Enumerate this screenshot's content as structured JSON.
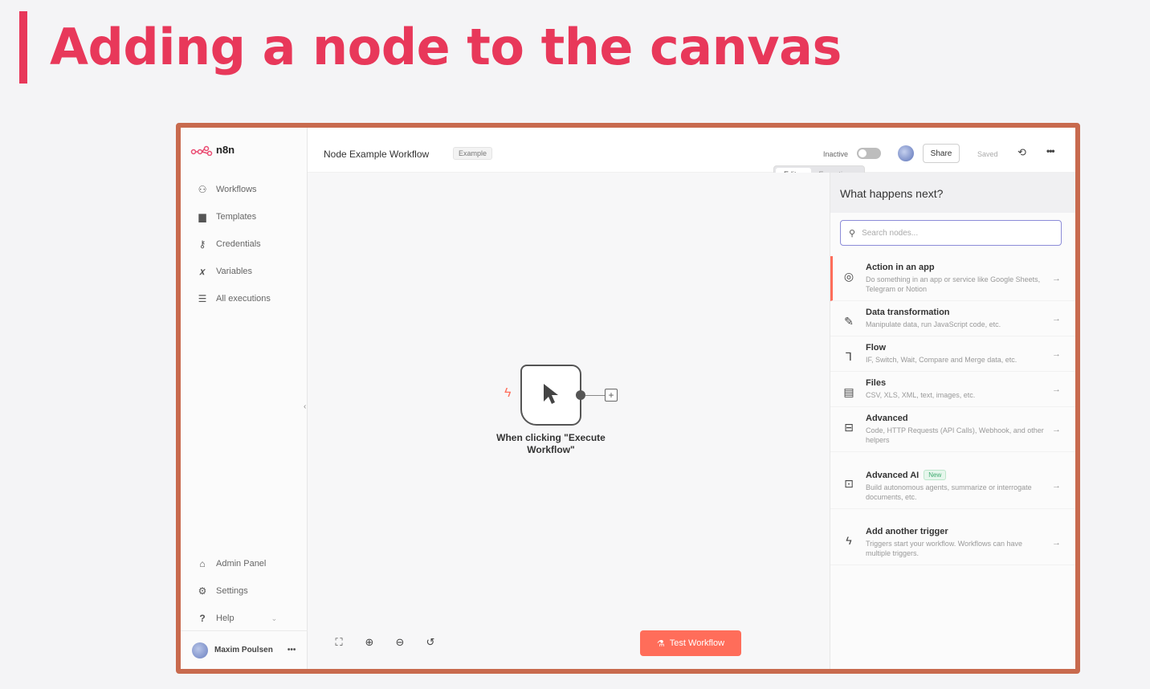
{
  "slide": {
    "title": "Adding a node to the canvas"
  },
  "app": {
    "brand": "n8n"
  },
  "sidebar": {
    "items": [
      {
        "label": "Workflows",
        "icon": "workflows-icon",
        "glyph": "⚇"
      },
      {
        "label": "Templates",
        "icon": "templates-icon",
        "glyph": "▆"
      },
      {
        "label": "Credentials",
        "icon": "key-icon",
        "glyph": "⚷"
      },
      {
        "label": "Variables",
        "icon": "variables-icon",
        "glyph": "𝑥"
      },
      {
        "label": "All executions",
        "icon": "list-icon",
        "glyph": "☰"
      }
    ],
    "bottom": [
      {
        "label": "Admin Panel",
        "icon": "home-icon",
        "glyph": "⌂"
      },
      {
        "label": "Settings",
        "icon": "gear-icon",
        "glyph": "⚙"
      },
      {
        "label": "Help",
        "icon": "question-icon",
        "glyph": "?"
      }
    ],
    "user_name": "Maxim Poulsen",
    "user_menu": "•••"
  },
  "header": {
    "workflow_name": "Node Example Workflow",
    "tag": "Example",
    "active_state": "Inactive",
    "share_label": "Share",
    "saved_label": "Saved",
    "more": "•••"
  },
  "mode_tabs": {
    "editor": "Editor",
    "executions": "Executions"
  },
  "canvas": {
    "node_label": "When clicking \"Execute Workflow\"",
    "test_button": "Test Workflow",
    "test_icon": "flask-icon"
  },
  "panel": {
    "title": "What happens next?",
    "search_placeholder": "Search nodes...",
    "search_value": "",
    "categories": [
      {
        "title": "Action in an app",
        "desc": "Do something in an app or service like Google Sheets, Telegram or Notion",
        "icon": "globe-icon",
        "glyph": "🌐"
      },
      {
        "title": "Data transformation",
        "desc": "Manipulate data, run JavaScript code, etc.",
        "icon": "pencil-icon",
        "glyph": "✎"
      },
      {
        "title": "Flow",
        "desc": "IF, Switch, Wait, Compare and Merge data, etc.",
        "icon": "branch-icon",
        "glyph": "⑂"
      },
      {
        "title": "Files",
        "desc": "CSV, XLS, XML, text, images, etc.",
        "icon": "file-icon",
        "glyph": "▤"
      },
      {
        "title": "Advanced",
        "desc": "Code, HTTP Requests (API Calls), Webhook, and other helpers",
        "icon": "toolbox-icon",
        "glyph": "⊟"
      },
      {
        "title": "Advanced AI",
        "badge": "New",
        "desc": "Build autonomous agents, summarize or interrogate documents, etc.",
        "icon": "robot-icon",
        "glyph": "⊡"
      },
      {
        "title": "Add another trigger",
        "desc": "Triggers start your workflow. Workflows can have multiple triggers.",
        "icon": "bolt-icon",
        "glyph": "ϟ"
      }
    ]
  },
  "colors": {
    "accent": "#ff6d5a",
    "slide_title": "#e8385a",
    "frame_border": "#c86a4e"
  }
}
